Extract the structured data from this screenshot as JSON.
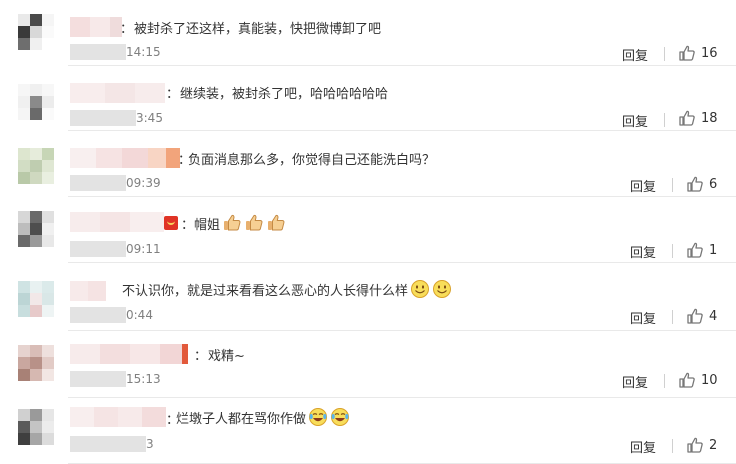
{
  "comments": [
    {
      "sep": "：",
      "text": "被封杀了还这样，真能装，快把微博卸了吧",
      "time": "14:15",
      "reply_label": "回复",
      "likes": "16",
      "emojis": []
    },
    {
      "sep": "：",
      "text": "继续装，被封杀了吧，哈哈哈哈哈哈",
      "time": "3:45",
      "reply_label": "回复",
      "likes": "18",
      "emojis": []
    },
    {
      "sep": "：",
      "text": "负面消息那么多，你觉得自己还能洗白吗？",
      "time": "09:39",
      "reply_label": "回复",
      "likes": "6",
      "emojis": []
    },
    {
      "sep": "：",
      "text": "帽姐",
      "time": "09:11",
      "reply_label": "回复",
      "likes": "1",
      "emojis": [
        "thumbs-up",
        "thumbs-up",
        "thumbs-up"
      ]
    },
    {
      "sep": "",
      "text": "不认识你，就是过来看看这么恶心的人长得什么样",
      "time": "0:44",
      "reply_label": "回复",
      "likes": "4",
      "emojis": [
        "smile",
        "smile"
      ]
    },
    {
      "sep": "：",
      "text": "戏精~",
      "time": "15:13",
      "reply_label": "回复",
      "likes": "10",
      "emojis": []
    },
    {
      "sep": "：",
      "text": "烂墩子人都在骂你作做",
      "time": "3",
      "reply_label": "回复",
      "likes": "2",
      "emojis": [
        "laugh-cry",
        "laugh-cry"
      ]
    }
  ],
  "icons": {
    "like": "thumbs-up-outline-icon"
  },
  "colors": {
    "text": "#333333",
    "time": "#808080",
    "divider": "#e9e9e9"
  }
}
